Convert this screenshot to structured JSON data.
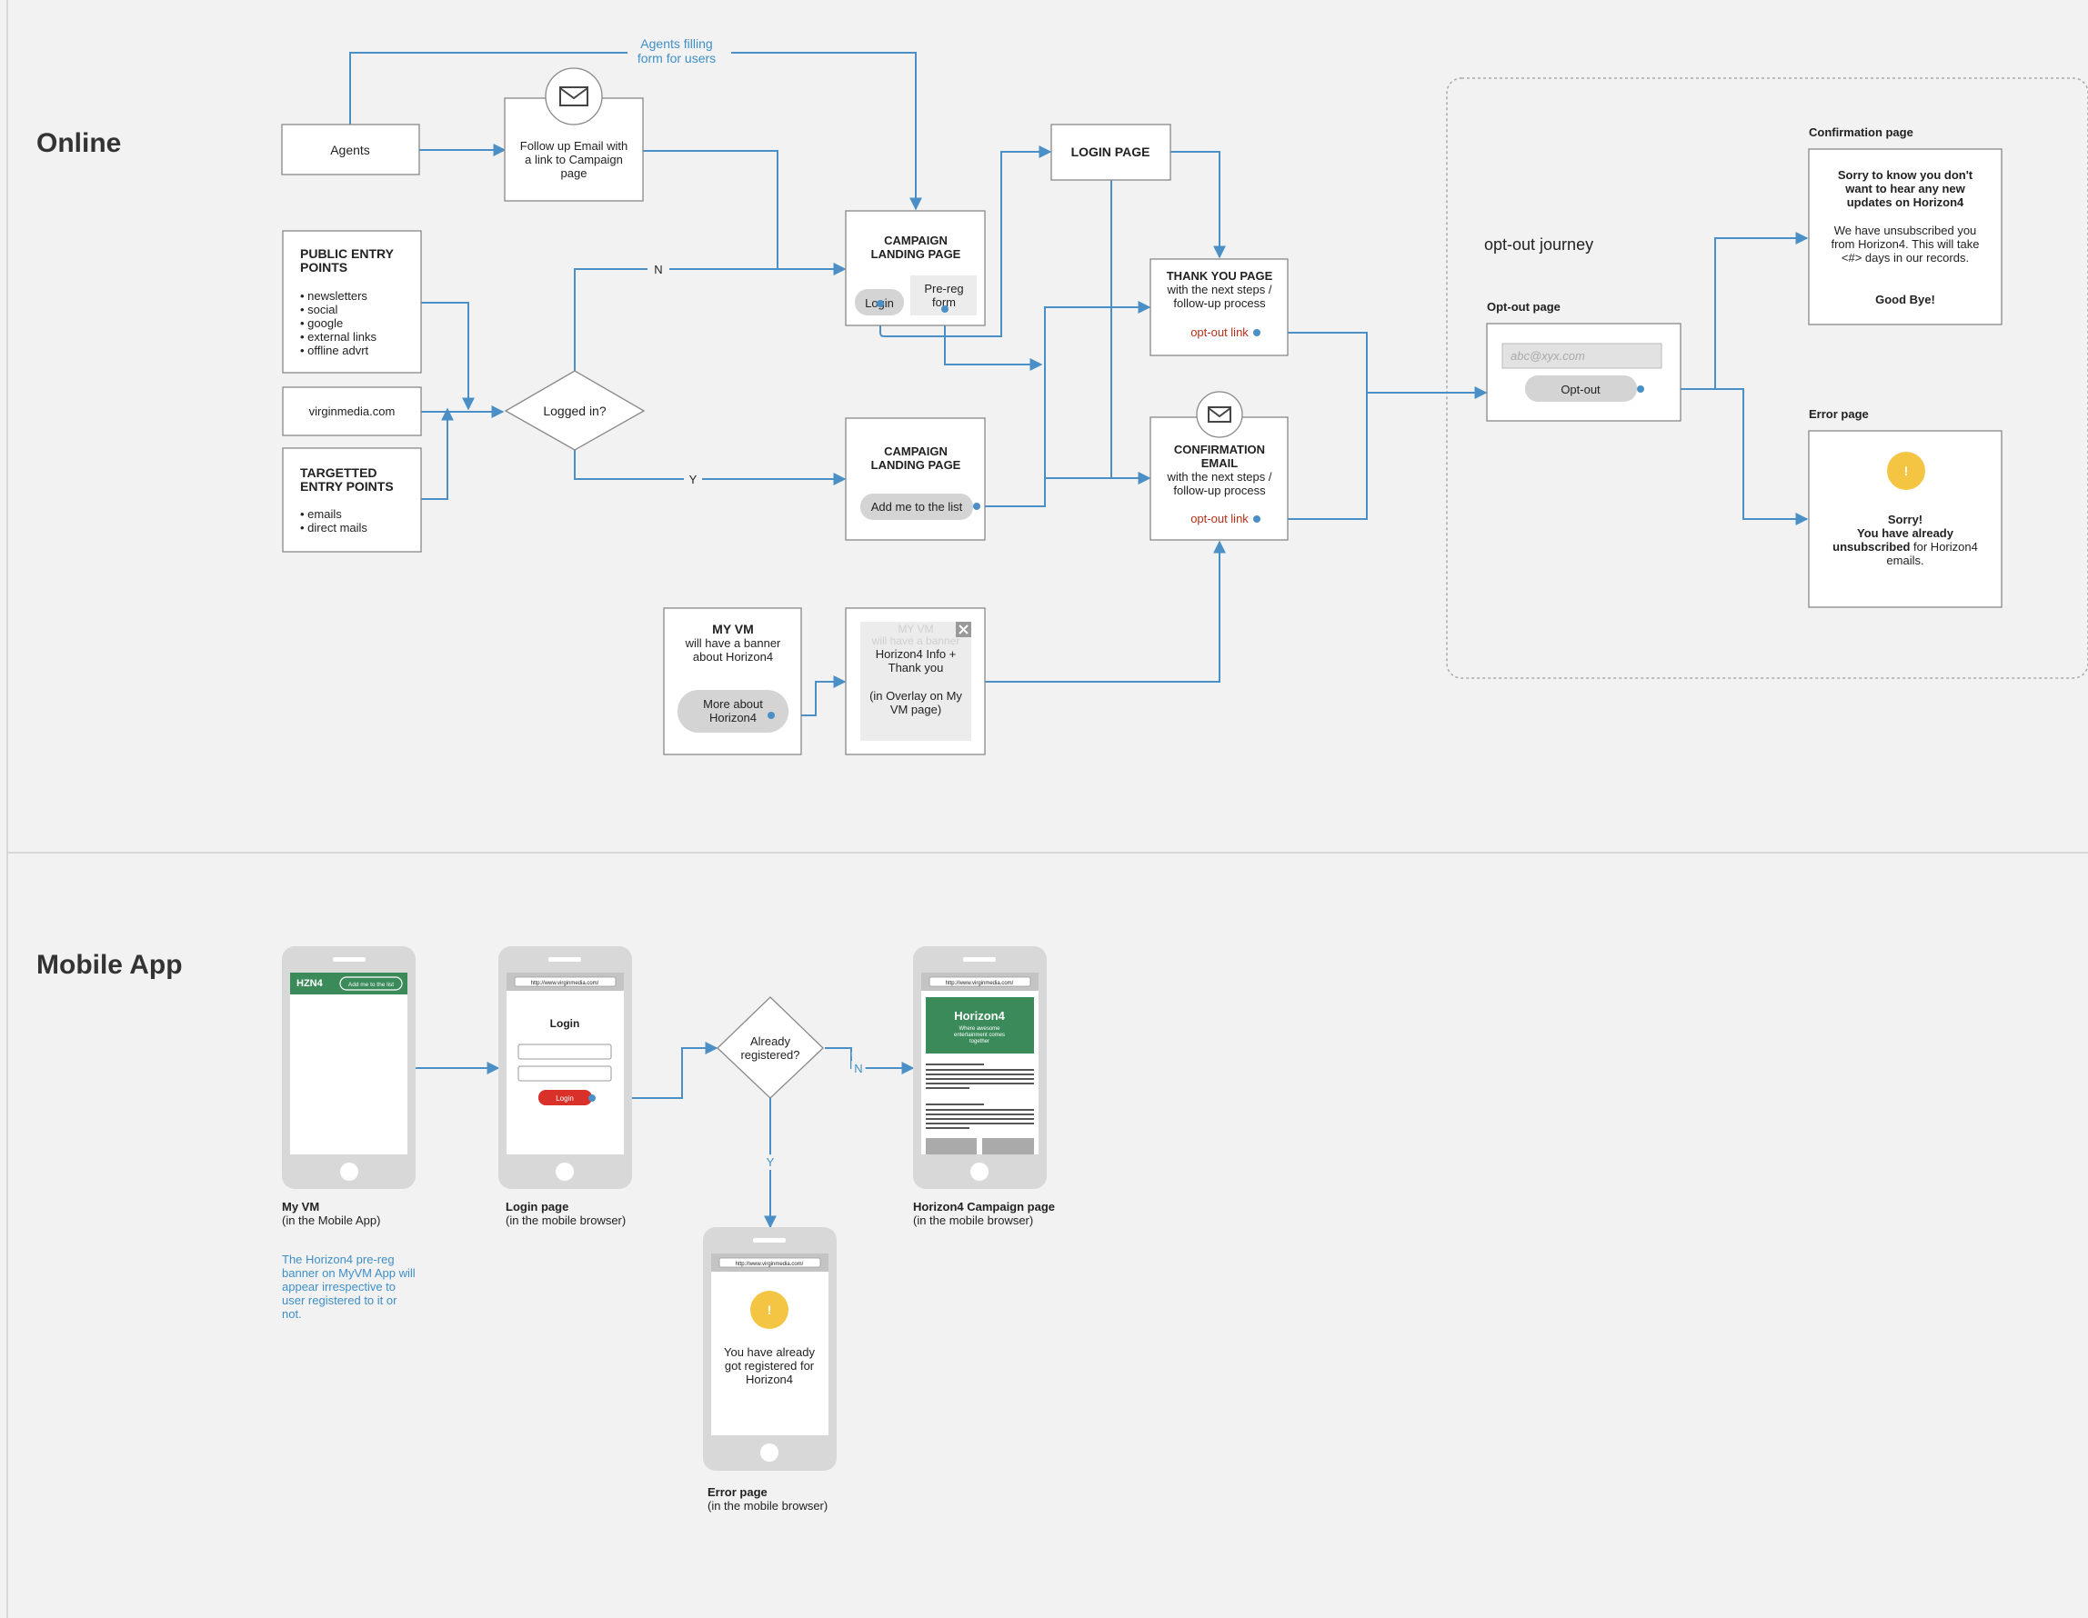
{
  "sections": {
    "online": "Online",
    "mobile": "Mobile App"
  },
  "online": {
    "agents": "Agents",
    "agents_filling": [
      "Agents filling",
      "form for users"
    ],
    "followup": [
      "Follow up Email with",
      "a link to Campaign",
      "page"
    ],
    "public": {
      "title": [
        "PUBLIC ENTRY",
        "POINTS"
      ],
      "items": [
        "• newsletters",
        "• social",
        "• google",
        "• external links",
        "• offline advrt"
      ]
    },
    "virginmedia": "virginmedia.com",
    "targetted": {
      "title": [
        "TARGETTED",
        "ENTRY POINTS"
      ],
      "items": [
        "• emails",
        "• direct mails"
      ]
    },
    "logged_in": "Logged in?",
    "branch_n": "N",
    "branch_y": "Y",
    "landing1": {
      "title": [
        "CAMPAIGN",
        "LANDING PAGE"
      ],
      "login": "Login",
      "prereg": [
        "Pre-reg",
        "form"
      ]
    },
    "landing2": {
      "title": [
        "CAMPAIGN",
        "LANDING PAGE"
      ],
      "add": "Add me to the list"
    },
    "login_page": "LOGIN PAGE",
    "thankyou": {
      "title": "THANK YOU PAGE",
      "sub": [
        "with the next steps /",
        "follow-up process"
      ],
      "link": "opt-out link"
    },
    "confirmation": {
      "title": [
        "CONFIRMATION",
        "EMAIL"
      ],
      "sub": [
        "with the next steps /",
        "follow-up process"
      ],
      "link": "opt-out link"
    },
    "myvm": {
      "title": "MY VM",
      "sub": [
        "will have a banner",
        "about Horizon4"
      ],
      "button": [
        "More about",
        "Horizon4"
      ]
    },
    "overlay": {
      "ghost": [
        "MY VM",
        "will have a banner"
      ],
      "text": [
        "Horizon4 Info +",
        "Thank you",
        "",
        "(in Overlay on My",
        "VM page)"
      ]
    },
    "optout": {
      "journey": "opt-out journey",
      "page_label": "Opt-out page",
      "placeholder": "abc@xyx.com",
      "button": "Opt-out",
      "confirm_label": "Confirmation page",
      "confirm_bold": [
        "Sorry to know you don't",
        "want to hear any new",
        "updates on Horizon4"
      ],
      "confirm_text": [
        "We have unsubscribed you",
        "from Horizon4. This will take",
        "<#> days in our records."
      ],
      "confirm_bye": "Good Bye!",
      "error_label": "Error page",
      "error_icon": "!",
      "error_bold": [
        "Sorry!",
        "You have already"
      ],
      "error_mixed_bold": "unsubscribed",
      "error_mixed_rest": " for Horizon4",
      "error_end": "emails."
    }
  },
  "mobile": {
    "phone1": {
      "brand": "HZN4",
      "banner_btn": "Add me to the list",
      "caption_bold": "My VM",
      "caption": "(in the Mobile App)",
      "note": [
        "The Horizon4 pre-reg",
        "banner on MyVM App will",
        "appear irrespective to",
        "user registered to it or",
        "not."
      ]
    },
    "phone2": {
      "url": "http://www.virginmedia.com/",
      "title": "Login",
      "button": "Login",
      "caption_bold": "Login page",
      "caption": "(in the mobile browser)"
    },
    "decision": [
      "Already",
      "registered?"
    ],
    "branch_n": "N",
    "branch_y": "Y",
    "phone3": {
      "url": "http://www.virginmedia.com/",
      "hero": "Horizon4",
      "hero_sub": [
        "Where awesome",
        "entertainment comes",
        "together"
      ],
      "caption_bold": "Horizon4 Campaign page",
      "caption": "(in the mobile browser)"
    },
    "phone4": {
      "url": "http://www.virginmedia.com/",
      "icon": "!",
      "text": [
        "You have already",
        "got registered for",
        "Horizon4"
      ],
      "caption_bold": "Error page",
      "caption": "(in the mobile browser)"
    }
  },
  "colors": {
    "connector": "#4a90c6",
    "opt_out_link": "#b5301a",
    "warning": "#f3c542",
    "brand_green": "#3a8a5a",
    "login_red": "#d9302a"
  },
  "icons": [
    "mail-icon",
    "close-icon",
    "warning-icon"
  ]
}
